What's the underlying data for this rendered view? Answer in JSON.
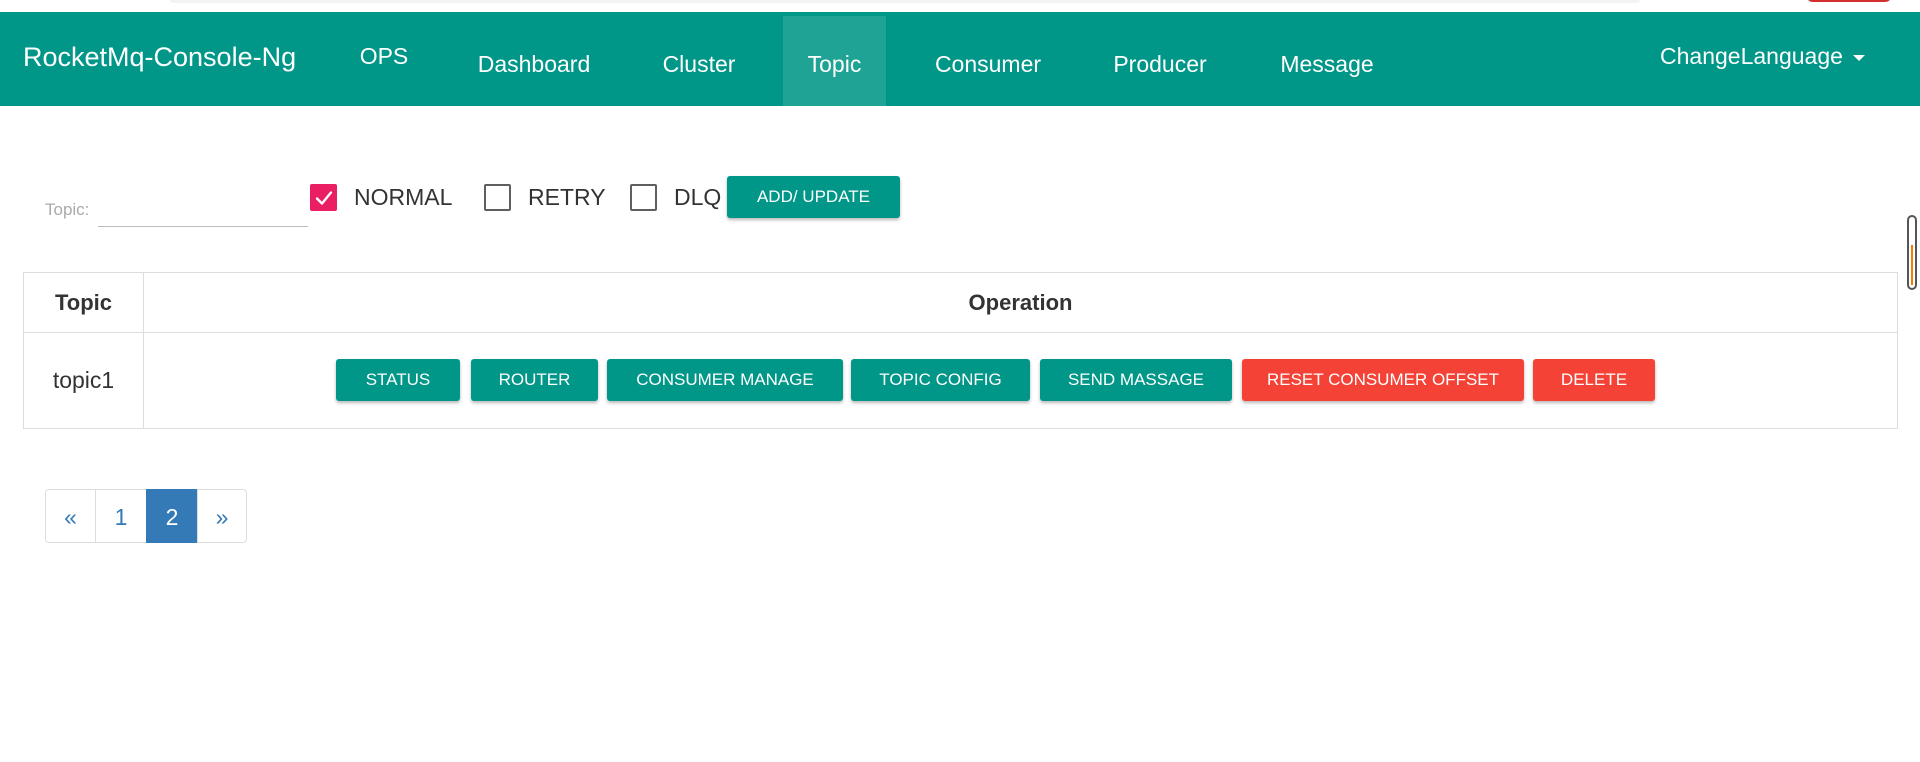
{
  "navbar": {
    "brand": "RocketMq-Console-Ng",
    "items": [
      {
        "label": "OPS"
      },
      {
        "label": "Dashboard"
      },
      {
        "label": "Cluster"
      },
      {
        "label": "Topic"
      },
      {
        "label": "Consumer"
      },
      {
        "label": "Producer"
      },
      {
        "label": "Message"
      }
    ],
    "active_item": "Topic",
    "language_label": "ChangeLanguage"
  },
  "filter": {
    "topic_label": "Topic:",
    "topic_value": "",
    "checkboxes": [
      {
        "label": "NORMAL",
        "checked": true
      },
      {
        "label": "RETRY",
        "checked": false
      },
      {
        "label": "DLQ",
        "checked": false
      }
    ],
    "add_update_label": "ADD/ UPDATE"
  },
  "table": {
    "headers": [
      "Topic",
      "Operation"
    ],
    "rows": [
      {
        "topic": "topic1",
        "operations": [
          "STATUS",
          "ROUTER",
          "CONSUMER MANAGE",
          "TOPIC CONFIG",
          "SEND MASSAGE",
          "RESET CONSUMER OFFSET",
          "DELETE"
        ]
      }
    ]
  },
  "pagination": {
    "prev": "«",
    "pages": [
      "1",
      "2"
    ],
    "current_page": "2",
    "next": "»"
  },
  "colors": {
    "primary": "#009688",
    "primary_active": "#1fa394",
    "danger": "#f44336",
    "checkbox_checked": "#e91e63",
    "pagination_active": "#337ab7"
  }
}
